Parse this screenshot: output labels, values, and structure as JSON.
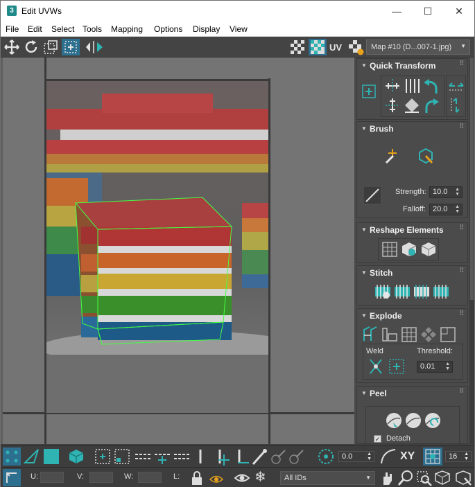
{
  "window": {
    "title": "Edit UVWs",
    "app_icon": "3",
    "minimize": "—",
    "maximize": "☐",
    "close": "✕"
  },
  "menu": [
    "File",
    "Edit",
    "Select",
    "Tools",
    "Mapping",
    "Options",
    "Display",
    "View"
  ],
  "toolbar": {
    "uv_label": "UV",
    "map_select": "Map #10 (D...007-1.jpg)"
  },
  "panel": {
    "quick_transform": {
      "title": "Quick Transform"
    },
    "brush": {
      "title": "Brush",
      "strength_label": "Strength:",
      "strength": "10.0",
      "falloff_label": "Falloff:",
      "falloff": "20.0"
    },
    "reshape": {
      "title": "Reshape Elements"
    },
    "stitch": {
      "title": "Stitch"
    },
    "explode": {
      "title": "Explode",
      "weld_label": "Weld",
      "threshold_label": "Threshold:",
      "threshold": "0.01"
    },
    "peel": {
      "title": "Peel",
      "detach_label": "Detach",
      "detach_checked": true
    }
  },
  "bottom": {
    "rotate_value": "0.0",
    "xy_label": "XY",
    "grid_value": "16",
    "u_label": "U:",
    "v_label": "V:",
    "w_label": "W:",
    "l_label": "L:",
    "id_select": "All IDs"
  },
  "colors": {
    "accent": "#2fb3b3",
    "uv_edge": "#44ff44",
    "panel": "#4a4a4a",
    "viewport": "#747474"
  }
}
